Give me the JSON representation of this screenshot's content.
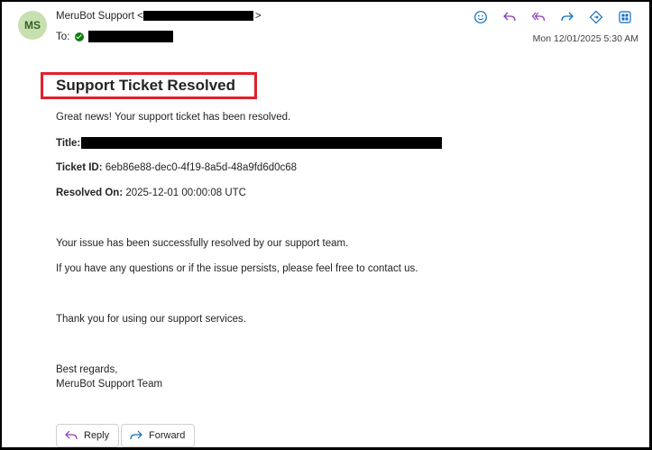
{
  "header": {
    "avatar_initials": "MS",
    "from_name": "MeruBot Support <",
    "from_suffix": ">",
    "to_label": "To:",
    "datetime": "Mon 12/01/2025 5:30 AM",
    "toolbar_icons": [
      "emoji-icon",
      "reply-icon",
      "reply-all-icon",
      "forward-icon",
      "teams-share-icon",
      "apps-icon"
    ]
  },
  "email": {
    "heading": "Support Ticket Resolved",
    "intro": "Great news! Your support ticket has been resolved.",
    "title_label": "Title:",
    "ticket_id_label": "Ticket ID:",
    "ticket_id_value": "6eb86e88-dec0-4f19-8a5d-48a9fd6d0c68",
    "resolved_on_label": "Resolved On:",
    "resolved_on_value": "2025-12-01 00:00:08 UTC",
    "line1": "Your issue has been successfully resolved by our support team.",
    "line2": "If you have any questions or if the issue persists, please feel free to contact us.",
    "thanks": "Thank you for using our support services.",
    "closing": "Best regards,",
    "signature": "MeruBot Support Team"
  },
  "actions": {
    "reply_label": "Reply",
    "forward_label": "Forward"
  },
  "colors": {
    "accent": "#0f6cbd",
    "highlight_border": "#e0202a",
    "avatar_bg": "#c7e0b0",
    "verified": "#107c10"
  }
}
